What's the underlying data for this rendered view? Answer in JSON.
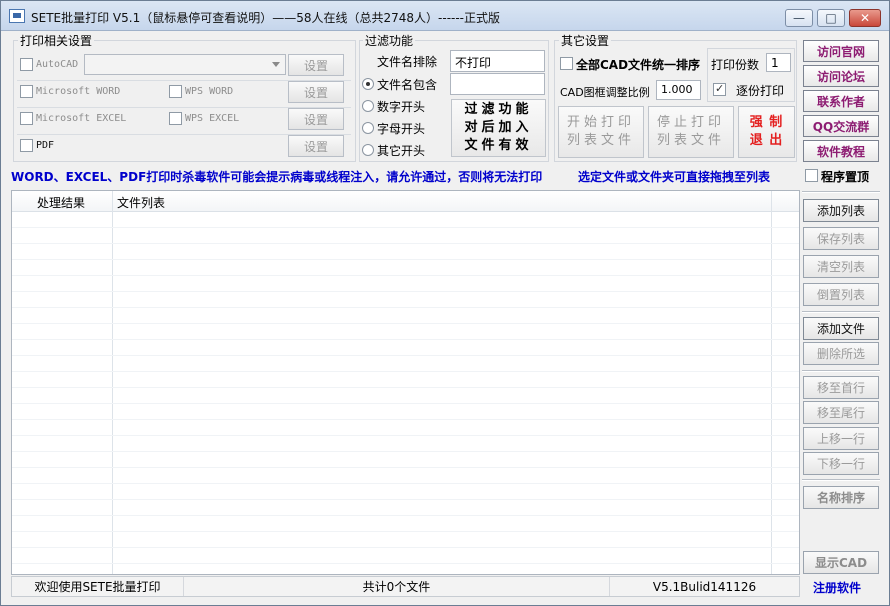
{
  "window": {
    "title": "SETE批量打印 V5.1（鼠标悬停可查看说明）——58人在线（总共2748人）------正式版",
    "minimize_glyph": "—",
    "maximize_glyph": "□",
    "close_glyph": "✕"
  },
  "print_settings": {
    "title": "打印相关设置",
    "autocad_label": "AutoCAD",
    "ms_word_label": "Microsoft WORD",
    "wps_word_label": "WPS WORD",
    "ms_excel_label": "Microsoft EXCEL",
    "wps_excel_label": "WPS EXCEL",
    "pdf_label": "PDF",
    "setup_label": "设置"
  },
  "filter": {
    "title": "过滤功能",
    "exclude_label": "文件名排除",
    "exclude_value": "不打印",
    "include_label": "文件名包含",
    "include_value": "",
    "digit_label": "数字开头",
    "letter_label": "字母开头",
    "other_label": "其它开头",
    "note_line1": "过滤功能",
    "note_line2": "对后加入",
    "note_line3": "文件有效"
  },
  "other_settings": {
    "title": "其它设置",
    "cad_sort_label": "全部CAD文件统一排序",
    "cad_ratio_label": "CAD图框调整比例",
    "cad_ratio_value": "1.000",
    "copies_label": "打印份数",
    "copies_value": "1",
    "collate_label": "逐份打印",
    "start_line1": "开始打印",
    "start_line2": "列表文件",
    "stop_line1": "停止打印",
    "stop_line2": "列表文件",
    "force_line1": "强 制",
    "force_line2": "退 出"
  },
  "links": {
    "official_site": "访问官网",
    "forum": "访问论坛",
    "contact": "联系作者",
    "qq_group": "QQ交流群",
    "tutorial": "软件教程"
  },
  "notice": {
    "warning": "WORD、EXCEL、PDF打印时杀毒软件可能会提示病毒或线程注入，请允许通过，否则将无法打印",
    "drag_hint": "选定文件或文件夹可直接拖拽至列表",
    "topmost_label": "程序置顶"
  },
  "table": {
    "columns": [
      "处理结果",
      "文件列表"
    ]
  },
  "side_buttons": {
    "add_list": "添加列表",
    "save_list": "保存列表",
    "clear_list": "清空列表",
    "reverse_list": "倒置列表",
    "add_files": "添加文件",
    "delete_selected": "删除所选",
    "move_first": "移至首行",
    "move_last": "移至尾行",
    "move_up": "上移一行",
    "move_down": "下移一行",
    "sort_name": "名称排序",
    "show_cad": "显示CAD"
  },
  "status": {
    "welcome": "欢迎使用SETE批量打印",
    "file_count": "共计0个文件",
    "version": "V5.1Bulid141126",
    "register": "注册软件"
  },
  "colors": {
    "link_text": "#8d1c72",
    "notice_blue": "#0000cc",
    "force_red": "#e41f1f"
  }
}
